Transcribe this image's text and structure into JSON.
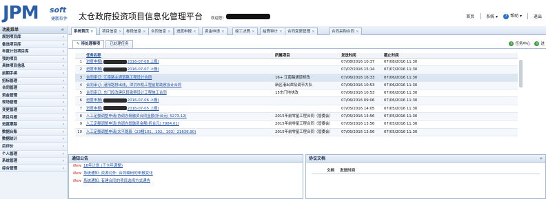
{
  "header": {
    "logo_text": "JPM",
    "logo_soft": "soft",
    "logo_sub": "捷鹏软件",
    "app_title": "太仓政府投资项目信息化管理平台",
    "welcome": "欢迎您!",
    "right": {
      "home": "首页",
      "system": "系统 ▾",
      "help": "帮助 ▾",
      "logout": "退出"
    }
  },
  "sidebar": {
    "title": "功能菜单",
    "items": [
      "规划项目库",
      "备选项目库",
      "年度计划项目库",
      "我的项目",
      "具体项目信息",
      "前期手续",
      "招标管理",
      "合同管理",
      "资金管理",
      "现场管理",
      "变更管理",
      "项目月报",
      "进度跟踪",
      "数据台账",
      "数据统计",
      "后评价",
      "个人管理",
      "系统管理",
      "综合管理"
    ]
  },
  "tabs": [
    {
      "label": "系统首页",
      "active": true
    },
    {
      "label": "项目信息"
    },
    {
      "label": "标段信息"
    },
    {
      "label": "合同信息"
    },
    {
      "label": "进度申报"
    },
    {
      "label": "资金申请"
    },
    {
      "label": "竣工决算"
    },
    {
      "label": "结算审计"
    },
    {
      "label": "合同变更管理"
    },
    {
      "label": "合同采购合同"
    }
  ],
  "main": {
    "subtabs": [
      {
        "label": "待处理事项",
        "active": true
      },
      {
        "label": "已处理任务"
      }
    ],
    "task_links": [
      "任务中心",
      "进"
    ],
    "columns": [
      "任务名称",
      "所属项目",
      "发送时间",
      "截止时间"
    ],
    "rows": [
      {
        "no": "1",
        "name_pre": "进度申报(",
        "name_post": "2016-07-08 上报)",
        "project": "",
        "sent": "07/08/2016 10:37",
        "due": "07/08/2016 11:30",
        "redact": true
      },
      {
        "no": "2",
        "name_pre": "进度申报(",
        "name_post": "2016-07-07 上报)",
        "project": "",
        "sent": "07/07/2016 15:14",
        "due": "07/07/2016 11:30",
        "redact": true
      },
      {
        "no": "3",
        "name_pre": "合同审订: 江南路主通道路工程设计合同",
        "name_post": "",
        "project": "16+ 江南路通道桥改",
        "sent": "07/06/2016 16:33",
        "due": "07/06/2016 11:30",
        "redact": false
      },
      {
        "no": "4",
        "name_pre": "合同审订: 港阳路排出线，泄洪市机工程前期勘察设计合同",
        "name_post": "",
        "project": "新区港出泄及调节大队",
        "sent": "07/06/2016 10:53",
        "due": "07/06/2016 11:30",
        "redact": false
      },
      {
        "no": "5",
        "name_pre": "合同审订: 东门段改建区段勘察设计工程施工合同",
        "name_post": "",
        "project": "15东门地块改",
        "sent": "07/06/2016 10:53",
        "due": "07/06/2016 11:30",
        "redact": false
      },
      {
        "no": "6",
        "name_pre": "进度申报(",
        "name_post": "2016-07-06 上报)",
        "project": "",
        "sent": "07/06/2016 09:06",
        "due": "07/06/2016 11:30",
        "redact": true
      },
      {
        "no": "7",
        "name_pre": "进度申报(",
        "name_post": "2016-07-05 上报)",
        "project": "",
        "sent": "07/05/2016 14:05",
        "due": "07/05/2016 11:30",
        "redact": true
      },
      {
        "no": "8",
        "name_pre": "人工定额调整申请(协调办既融资合同金额(折合元) 5273.12)",
        "name_post": "",
        "project": "2015年前零星工程合同（管委会）",
        "sent": "07/05/2016 13:56",
        "due": "07/05/2016 11:30",
        "redact": false
      },
      {
        "no": "9",
        "name_pre": "人工定额调整申请(协调办既融资金额(折合元) 7984.01)",
        "name_post": "",
        "project": "2015年前零星工程合同（管委会）",
        "sent": "07/05/2016 13:56",
        "due": "07/05/2016 11:30",
        "redact": false
      },
      {
        "no": "10",
        "name_pre": "人工定额调整申请(太平路段（23幢101、102、103）21636.90)",
        "name_post": "",
        "project": "2015年前零星工程合同（管委会）",
        "sent": "07/05/2016 13:56",
        "due": "07/05/2016 11:30",
        "redact": false
      }
    ]
  },
  "notice": {
    "title": "通知公告",
    "new_label": "New",
    "items": [
      "16年计划 (下卡年调整)",
      "系统通知: 资源对外: 合同编码的申报变化",
      "系统通知: 有建合同的项目选择方式通告"
    ]
  },
  "docs": {
    "title": "协议文档",
    "columns": [
      "文档",
      "发送时间"
    ]
  }
}
